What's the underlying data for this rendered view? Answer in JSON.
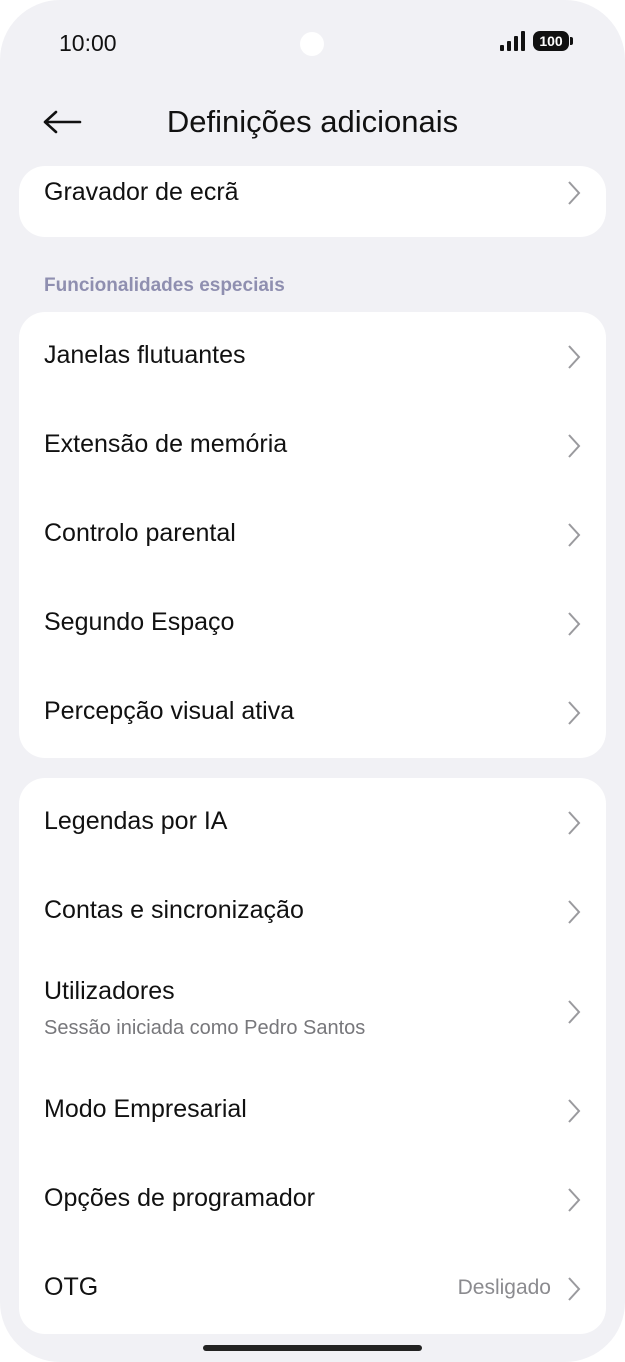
{
  "status_bar": {
    "time": "10:00",
    "battery": "100"
  },
  "header": {
    "title": "Definições adicionais",
    "back_icon": "arrow-left-icon"
  },
  "top_card": {
    "items": [
      {
        "label": "Gravador de ecrã"
      }
    ]
  },
  "special_section": {
    "title": "Funcionalidades especiais",
    "items": [
      {
        "label": "Janelas flutuantes"
      },
      {
        "label": "Extensão de memória"
      },
      {
        "label": "Controlo parental"
      },
      {
        "label": "Segundo Espaço"
      },
      {
        "label": "Percepção visual ativa"
      }
    ]
  },
  "other_card": {
    "items": [
      {
        "label": "Legendas por IA"
      },
      {
        "label": "Contas e sincronização"
      },
      {
        "label": "Utilizadores",
        "sub": "Sessão iniciada como Pedro Santos"
      },
      {
        "label": "Modo Empresarial"
      },
      {
        "label": "Opções de programador"
      },
      {
        "label": "OTG",
        "value": "Desligado"
      }
    ]
  },
  "colors": {
    "background": "#f1f1f5",
    "card": "#ffffff",
    "section_title": "#8f8fb0",
    "chevron": "#9a9a9e"
  }
}
